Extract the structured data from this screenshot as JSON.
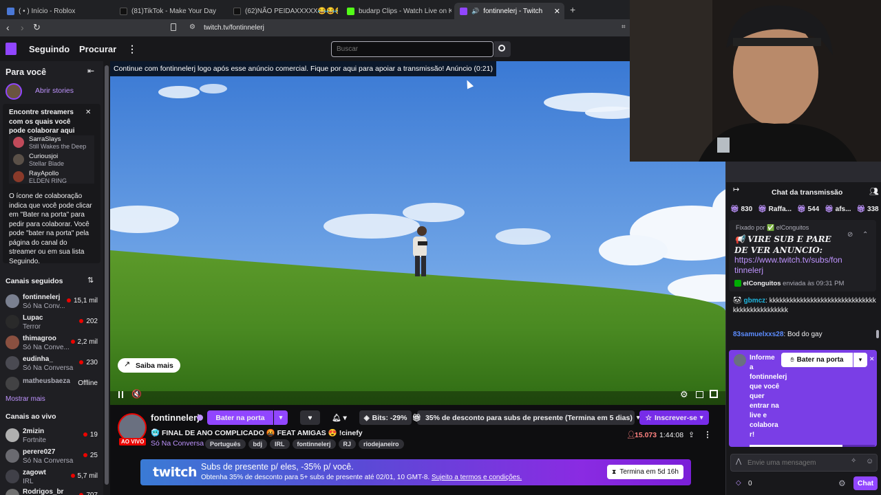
{
  "browser": {
    "tabs": [
      {
        "title": "( • ) Início - Roblox",
        "color": "#4a78d6"
      },
      {
        "title": "(81)TikTok - Make Your Day",
        "color": "#111111"
      },
      {
        "title": "(62)NÃO PEIDAXXXXX😂😂😂😂 Pi",
        "color": "#111111"
      },
      {
        "title": "budarp Clips - Watch Live on Kick",
        "color": "#53fc18"
      },
      {
        "title": "fontinnelerj - Twitch",
        "color": "#9146ff"
      }
    ],
    "url": "twitch.tv/fontinnelerj",
    "new_tab": "+"
  },
  "nav": {
    "following": "Seguindo",
    "browse": "Procurar",
    "more": "⋮",
    "search_placeholder": "Buscar"
  },
  "sidebar": {
    "for_you": "Para você",
    "open_stories": "Abrir stories",
    "collab_card": {
      "title": "Encontre streamers com os quais você pode colaborar aqui",
      "items": [
        {
          "name": "SarraSlays",
          "game": "Still Wakes the Deep"
        },
        {
          "name": "Curiousjoi",
          "game": "Stellar Blade"
        },
        {
          "name": "RayApollo",
          "game": "ELDEN RING"
        }
      ],
      "description": "O ícone de colaboração indica que você pode clicar em \"Bater na porta\" para pedir para colaborar. Você pode \"bater na porta\" pela página do canal do streamer ou em sua lista Seguindo."
    },
    "followed_header": "Canais seguidos",
    "followed": [
      {
        "name": "fontinnelerj",
        "game": "Só Na Conv...",
        "viewers": "15,1 mil"
      },
      {
        "name": "Lupac",
        "game": "Terror",
        "viewers": "202"
      },
      {
        "name": "thimagroo",
        "game": "Só Na Conve...",
        "viewers": "2,2 mil"
      },
      {
        "name": "eudinha_",
        "game": "Só Na Conversa",
        "viewers": "230"
      },
      {
        "name": "matheusbaeza",
        "game": "",
        "viewers": "Offline"
      }
    ],
    "show_more": "Mostrar mais",
    "live_header": "Canais ao vivo",
    "live": [
      {
        "name": "2mizin",
        "game": "Fortnite",
        "viewers": "19"
      },
      {
        "name": "perere027",
        "game": "Só Na Conversa",
        "viewers": "25"
      },
      {
        "name": "zagowt",
        "game": "IRL",
        "viewers": "5,7 mil"
      },
      {
        "name": "Rodrigos_br",
        "game": "",
        "viewers": "707"
      }
    ]
  },
  "player": {
    "ad_banner": "Continue com fontinnelerj logo após esse anúncio comercial. Fique por aqui para apoiar a transmissão! Anúncio (0:21)",
    "learn_more": "Saiba mais"
  },
  "channel": {
    "name": "fontinnelerj",
    "live_badge": "AO VIVO",
    "knock": "Bater na porta",
    "bits": "Bits: -29%",
    "gift_promo": "35% de desconto para subs de presente (Termina em 5 dias)",
    "subscribe": "Inscrever-se",
    "title": "🥶 FINAL DE ANO COMPLICADO 🤬 FEAT AMIGAS 😍 !cinefy",
    "category": "Só Na Conversa",
    "tags": [
      "Português",
      "bdj",
      "IRL",
      "fontinnelerj",
      "RJ",
      "riodejaneiro"
    ],
    "viewers": "15.073",
    "uptime": "1:44:08"
  },
  "promo": {
    "logo": "twitch",
    "headline": "Subs de presente p/ eles, -35% p/ você.",
    "sub": "Obtenha 35% de desconto para 5+ subs de presente até 02/01, 10 GMT-8.",
    "terms": "Sujeito a termos e condições.",
    "ends": "Termina em 5d 16h"
  },
  "chat": {
    "header": "Chat da transmissão",
    "leaderboard": [
      {
        "label": "830"
      },
      {
        "label": "Raffa..."
      },
      {
        "label": "544"
      },
      {
        "label": "afs..."
      },
      {
        "label": "338"
      }
    ],
    "pinned_by": "Fixado por ✅ elConguitos",
    "pinned_text": "📢 VIRE SUB E PARE DE VER ANUNCIO:",
    "pinned_link": "https://www.twitch.tv/subs/fontinnelerj",
    "sender": "elConguitos",
    "sent_at": "enviada às 09:31 PM",
    "messages": [
      {
        "user": "gbmcz",
        "color": "#1fb7e0",
        "text": "kkkkkkkkkkkkkkkkkkkkkkkkkkkkkkkkkkkkkkkkkkkkkkk"
      },
      {
        "user": "83samuelxxs28",
        "color": "#5c8cff",
        "text": "Bod do gay"
      }
    ],
    "knock_prompt": "Informe a fontinnelerj que você quer entrar na live e colabora r!",
    "knock_button": "Bater na porta",
    "input_placeholder": "Envie uma mensagem",
    "points": "0",
    "chat_button": "Chat"
  },
  "colors": {
    "accent": "#9146ff",
    "live": "#eb0400",
    "bg": "#0e0e10"
  }
}
